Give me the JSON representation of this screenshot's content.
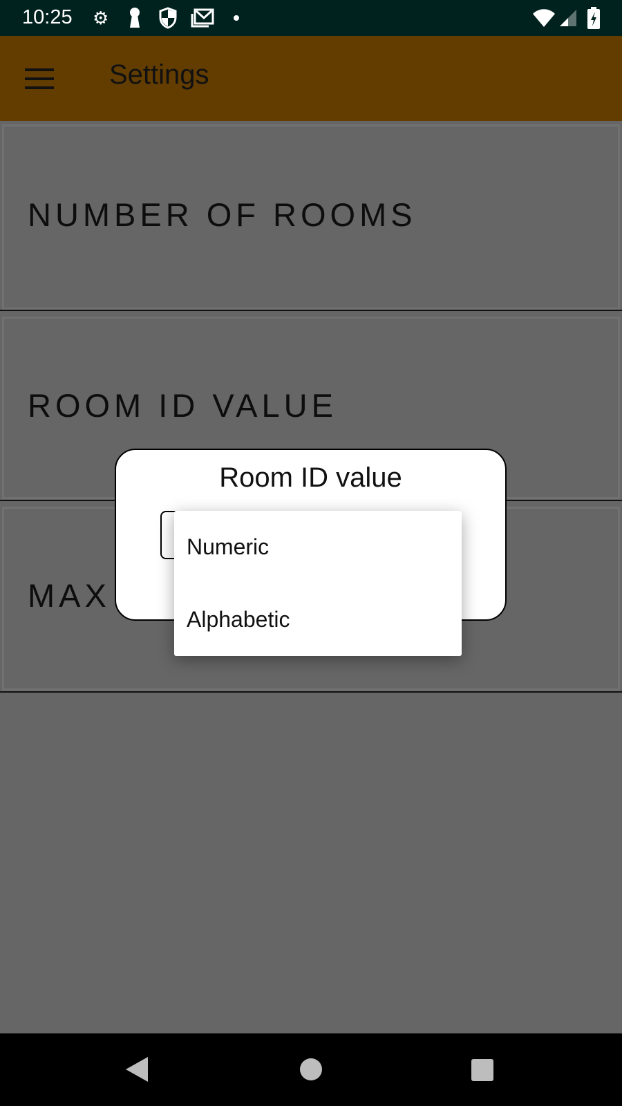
{
  "status_bar": {
    "time": "10:25",
    "left_icons": [
      "gear-icon",
      "keyhole-icon",
      "shield-icon",
      "gmail-icon",
      "dot-icon"
    ],
    "right_icons": [
      "wifi-icon",
      "signal-icon",
      "battery-charging-icon"
    ]
  },
  "app_bar": {
    "title": "Settings",
    "menu_icon": "hamburger-menu-icon"
  },
  "colors": {
    "app_bar": "#633d00",
    "status_bar": "#00221e",
    "background": "#666666"
  },
  "settings": [
    {
      "label": "NUMBER OF ROOMS"
    },
    {
      "label": "ROOM ID VALUE"
    },
    {
      "label": "MAX"
    }
  ],
  "dialog": {
    "title": "Room ID value",
    "options": [
      "Numeric",
      "Alphabetic"
    ]
  }
}
